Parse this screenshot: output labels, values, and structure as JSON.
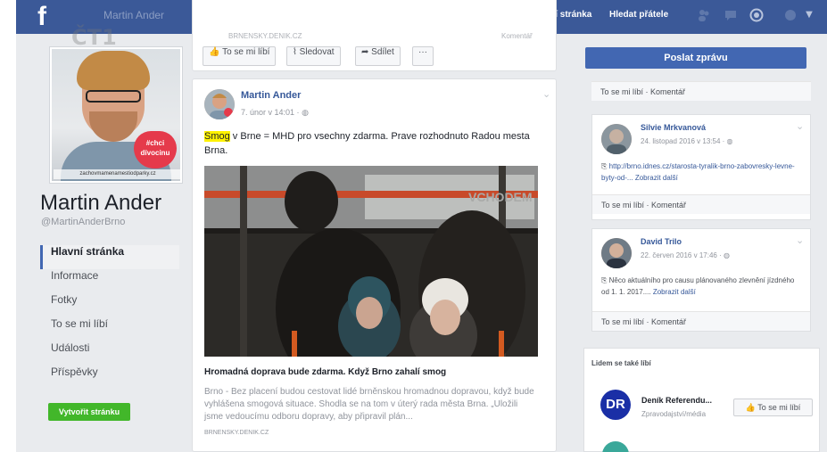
{
  "topbar": {
    "logo": "f",
    "user_name": "Martin Ander",
    "home_link": "Hlavní stránka",
    "find_friends_link": "Hledat přátele",
    "icons": [
      "friends-icon",
      "messages-icon",
      "globe-icon",
      "help-icon",
      "dropdown-icon"
    ]
  },
  "watermark": "ČT1",
  "profile": {
    "photo_badge": "#chci dívocinu",
    "photo_caption": "zachovmamenamestiodparky.cz",
    "name": "Martin Ander",
    "handle": "@MartinAnderBrno"
  },
  "nav": {
    "items": [
      {
        "label": "Hlavní stránka",
        "active": true
      },
      {
        "label": "Informace",
        "active": false
      },
      {
        "label": "Fotky",
        "active": false
      },
      {
        "label": "To se mi líbí",
        "active": false
      },
      {
        "label": "Události",
        "active": false
      },
      {
        "label": "Příspěvky",
        "active": false
      }
    ],
    "create_page": "Vytvořit stránku"
  },
  "top_post": {
    "faded_source": "BRNENSKY.DENIK.CZ",
    "faded_meta": "Komentář",
    "actions": {
      "like": "To se mi líbí",
      "follow": "Sledovat",
      "share": "Sdílet",
      "more": "···"
    }
  },
  "post": {
    "author": "Martin Ander",
    "time": "7. únor v 14:01 ·",
    "text_highlight": "Smog",
    "text_rest": " v Brne = MHD pro vsechny zdarma. Prave rozhodnuto Radou mesta Brna.",
    "image_sign": "VCHODEM",
    "link_title": "Hromadná doprava bude zdarma. Když Brno zahalí smog",
    "link_desc": "Brno - Bez placení budou cestovat lidé brněnskou hromadnou dopravou, když bude vyhlášena smogová situace. Shodla se na tom v úterý rada města Brna. „Uložili jsme vedoucímu odboru dopravy, aby připravil plán...",
    "link_source": "BRNENSKY.DENIK.CZ"
  },
  "right": {
    "send_message": "Poslat zprávu",
    "bar_label": "To se mi líbí · Komentář",
    "posts": [
      {
        "name": "Silvie Mrkvanová",
        "time": "24. listopad 2016 v 13:54 ·",
        "text": "http://brno.idnes.cz/starosta-tyralik-brno-zabovresky-levne-byty-od-...",
        "more": "Zobrazit další"
      },
      {
        "name": "David Trilo",
        "time": "22. červen 2016 v 17:46 ·",
        "text": "Něco aktuálního pro causu plánovaného zlevnění jízdného od 1. 1. 2017....",
        "more": "Zobrazit další"
      }
    ],
    "related": {
      "title": "Lidem se také líbí",
      "initials": "DR",
      "name": "Deník Referendu...",
      "category": "Zpravodajství/média",
      "like": "To se mi líbí"
    }
  }
}
